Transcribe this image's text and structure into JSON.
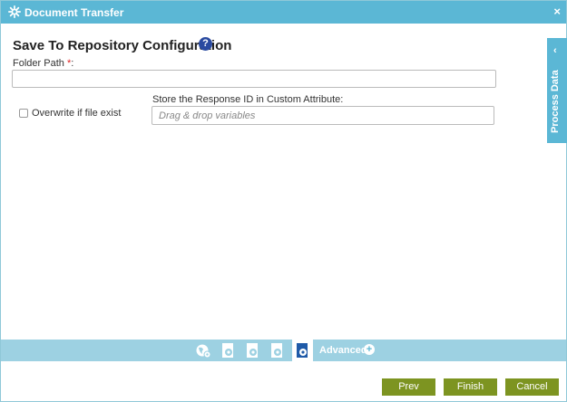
{
  "window": {
    "title": "Document Transfer",
    "close_glyph": "×",
    "title_icon": "gear-icon",
    "close_icon": "close-icon"
  },
  "form": {
    "heading": "Save To Repository Configuration",
    "help_glyph": "?",
    "folder_path": {
      "label": "Folder Path",
      "required_mark": "*",
      "colon": ":",
      "value": ""
    },
    "overwrite": {
      "label": "Overwrite if file exist",
      "checked": false
    },
    "store_response": {
      "label": "Store the Response ID in Custom Attribute:",
      "placeholder": "Drag & drop variables"
    }
  },
  "side_panel": {
    "label": "Process Data",
    "chevron": "‹"
  },
  "bottom_bar": {
    "icons": [
      "globe-settings-icon",
      "document-settings-icon",
      "document-settings-icon",
      "document-settings-icon",
      "active-document-settings-icon"
    ],
    "advanced_label": "Advanced",
    "advanced_plus": "+"
  },
  "buttons": {
    "prev": "Prev",
    "finish": "Finish",
    "cancel": "Cancel"
  },
  "colors": {
    "titlebar": "#5bb7d5",
    "bottom_bar": "#9dd1e2",
    "button": "#7d9421",
    "help": "#2a4aa0",
    "required": "#e02020"
  }
}
